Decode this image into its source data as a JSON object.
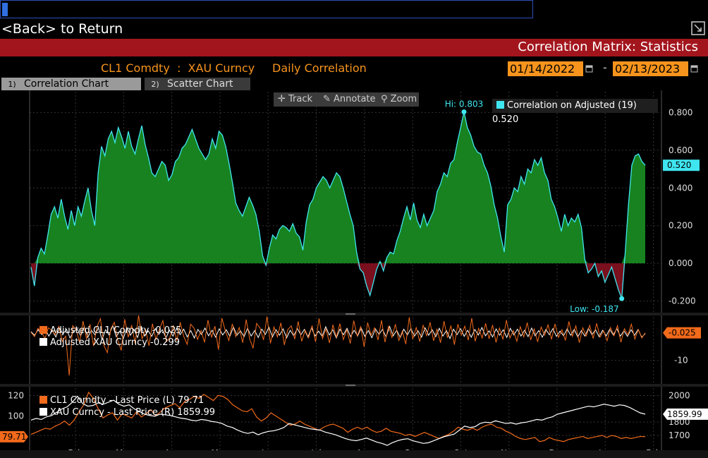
{
  "nav": {
    "back_label": "<Back> to Return"
  },
  "header": {
    "title": "Correlation Matrix: Statistics"
  },
  "params": {
    "pair": "CL1 Comdty  :  XAU Curncy",
    "mode": "Daily Correlation",
    "start_date": "01/14/2022",
    "end_date": "02/13/2023",
    "separator": "-"
  },
  "tabs": [
    {
      "num": "1)",
      "label": "Correlation Chart"
    },
    {
      "num": "2)",
      "label": "Scatter Chart"
    }
  ],
  "toolbar": {
    "track": "Track",
    "annotate": "Annotate",
    "zoom": "Zoom"
  },
  "colors": {
    "green": "#17821f",
    "red": "#7a0f1e",
    "cyan": "#3fe6f0",
    "orange": "#f26a1b",
    "white": "#ffffff",
    "accent": "#f7941d",
    "title_bg": "#a3151d"
  },
  "months": [
    "Feb",
    "Mar",
    "Apr",
    "May",
    "Jun",
    "Jul",
    "Aug",
    "Sep",
    "Oct",
    "Nov",
    "Dec",
    "Jan",
    "Feb"
  ],
  "chart_data": [
    {
      "type": "area",
      "legend": "Correlation on Adjusted (19) 0.520",
      "last_value": "0.520",
      "hi_label": "Hi: 0.803",
      "low_label": "Low: -0.187",
      "ylim": [
        -0.25,
        0.85
      ],
      "yticks": [
        "0.800",
        "0.600",
        "0.400",
        "0.200",
        "0.000",
        "-0.200"
      ],
      "ytick_values": [
        0.8,
        0.6,
        0.4,
        0.2,
        0.0,
        -0.2
      ],
      "series": [
        {
          "name": "Correlation on Adjusted (19)",
          "values": [
            -0.02,
            -0.12,
            0.03,
            0.08,
            0.05,
            0.15,
            0.26,
            0.3,
            0.24,
            0.34,
            0.25,
            0.18,
            0.28,
            0.2,
            0.3,
            0.25,
            0.33,
            0.4,
            0.28,
            0.2,
            0.48,
            0.62,
            0.57,
            0.66,
            0.7,
            0.64,
            0.72,
            0.67,
            0.61,
            0.7,
            0.62,
            0.58,
            0.66,
            0.73,
            0.63,
            0.56,
            0.48,
            0.46,
            0.5,
            0.54,
            0.52,
            0.44,
            0.47,
            0.54,
            0.56,
            0.61,
            0.63,
            0.67,
            0.71,
            0.66,
            0.61,
            0.58,
            0.55,
            0.58,
            0.66,
            0.61,
            0.7,
            0.68,
            0.62,
            0.53,
            0.43,
            0.32,
            0.28,
            0.25,
            0.3,
            0.35,
            0.31,
            0.26,
            0.17,
            0.04,
            -0.01,
            0.08,
            0.15,
            0.13,
            0.18,
            0.2,
            0.19,
            0.17,
            0.21,
            0.16,
            0.14,
            0.07,
            0.22,
            0.31,
            0.34,
            0.4,
            0.43,
            0.46,
            0.44,
            0.4,
            0.44,
            0.48,
            0.46,
            0.4,
            0.33,
            0.26,
            0.2,
            0.06,
            -0.03,
            -0.05,
            -0.12,
            -0.17,
            -0.1,
            -0.03,
            0.01,
            -0.04,
            0.03,
            0.06,
            0.05,
            0.12,
            0.17,
            0.24,
            0.3,
            0.23,
            0.32,
            0.23,
            0.19,
            0.26,
            0.2,
            0.24,
            0.28,
            0.38,
            0.42,
            0.48,
            0.46,
            0.53,
            0.55,
            0.64,
            0.72,
            0.803,
            0.72,
            0.68,
            0.62,
            0.59,
            0.58,
            0.52,
            0.48,
            0.41,
            0.31,
            0.24,
            0.14,
            0.06,
            0.31,
            0.34,
            0.4,
            0.38,
            0.46,
            0.42,
            0.5,
            0.48,
            0.55,
            0.52,
            0.56,
            0.48,
            0.44,
            0.34,
            0.3,
            0.24,
            0.17,
            0.26,
            0.2,
            0.24,
            0.22,
            0.26,
            0.19,
            0.02,
            -0.05,
            -0.03,
            0.0,
            -0.07,
            -0.04,
            -0.1,
            -0.06,
            -0.02,
            -0.08,
            -0.14,
            -0.187,
            0.05,
            0.31,
            0.52,
            0.57,
            0.58,
            0.54,
            0.52
          ]
        }
      ]
    },
    {
      "type": "line",
      "series": [
        {
          "name": "Adjusted CL1 Comdty",
          "last": "-0.025",
          "values": [
            0.2,
            -1.4,
            1.6,
            0.4,
            -2.1,
            1.8,
            0.9,
            -0.7,
            2.3,
            -3.1,
            -1.2,
            -15.5,
            2.6,
            1.1,
            -3.4,
            4.2,
            -2.3,
            3.1,
            -4.8,
            2.2,
            5.1,
            -4.6,
            -7.2,
            1.5,
            3.8,
            -2.7,
            -6.4,
            4.9,
            -1.6,
            2.8,
            -3.9,
            6.3,
            -2.2,
            1.2,
            -4.7,
            3.3,
            -2.4,
            1.3,
            4.4,
            -3.2,
            -1.8,
            2.7,
            -2.9,
            3.8,
            -1.3,
            -4.2,
            3.1,
            1.6,
            -2.4,
            0.8,
            -3.5,
            4.6,
            -1.7,
            2.4,
            -6.1,
            5.3,
            0.7,
            -2.8,
            3.2,
            -1.4,
            1.9,
            -3.6,
            4.8,
            -2.2,
            -5.6,
            3.4,
            1.7,
            -2.6,
            5.9,
            -3.8,
            2.1,
            -1.5,
            3.6,
            -4.4,
            1.2,
            2.5,
            -2.3,
            4.1,
            -3.1,
            0.9,
            -1.8,
            2.6,
            -3.3,
            5.2,
            -2.1,
            1.4,
            -3.7,
            2.9,
            -1.6,
            3.3,
            -2.5,
            1.1,
            -3.9,
            4.4,
            -1.2,
            2.2,
            -5.1,
            3.7,
            -0.9,
            1.8,
            -2.6,
            4.5,
            -3.4,
            2.3,
            -1.7,
            3.1,
            -2.8,
            0.6,
            -4.1,
            5.6,
            -2.3,
            1.9,
            -3.2,
            2.7,
            -1.1,
            3.8,
            -2.9,
            1.3,
            -3.6,
            4.2,
            -1.8,
            2.6,
            -4.3,
            3.1,
            -0.8,
            2.4,
            -2.7,
            5.3,
            -3.1,
            1.6,
            -1.9,
            3.4,
            -2.2,
            2.8,
            -3.5,
            1.7,
            -2.4,
            4.6,
            -1.9,
            0.8,
            -3.1,
            2.2,
            -1.5,
            3.7,
            -2.6,
            1.4,
            -3.3,
            2.1,
            -0.9,
            2.9,
            -2.4,
            3.2,
            -1.7,
            1.1,
            -2.8,
            4.1,
            -1.3,
            2.5,
            -3.6,
            1.8,
            -1.2,
            2.7,
            -2.1,
            3.4,
            -1.6,
            0.7,
            -2.9,
            1.9,
            -1.1,
            2.6,
            -3.4,
            1.5,
            -0.8,
            3.1,
            -2.3,
            1.2,
            -1.9,
            -0.025
          ]
        },
        {
          "name": "Adjusted XAU Curncy",
          "last": "-0.299",
          "values": [
            0.4,
            -0.9,
            1.1,
            -0.6,
            1.4,
            -1.2,
            0.8,
            -1.5,
            1.7,
            -0.4,
            1.2,
            -1.9,
            0.6,
            1.3,
            -1.1,
            2.2,
            -1.6,
            0.9,
            -0.7,
            1.8,
            -2.4,
            1.1,
            -0.8,
            2.6,
            -1.4,
            0.6,
            -2.1,
            1.9,
            -0.9,
            1.2,
            -1.7,
            2.3,
            -1.2,
            0.7,
            -1.3,
            1.5,
            -0.6,
            1.1,
            -1.8,
            0.9,
            -1.2,
            1.6,
            -0.7,
            1.3,
            -1.5,
            0.8,
            -1.9,
            1.2,
            -0.6,
            1.7,
            -1.1,
            0.9,
            -1.6,
            1.4,
            -0.8,
            1.1,
            -1.3,
            2.1,
            -0.9,
            0.7,
            -1.4,
            1.6,
            -1.2,
            0.8,
            -1.7,
            1.3,
            -0.6,
            2.0,
            -1.5,
            1.1,
            -0.9,
            1.4,
            -1.8,
            0.9,
            -1.1,
            1.5,
            -0.7,
            1.2,
            -1.6,
            1.8,
            -1.2,
            0.6,
            -1.3,
            2.2,
            -0.8,
            1.1,
            -1.9,
            1.3,
            -0.7,
            1.6,
            -1.4,
            0.9,
            -1.1,
            1.7,
            -1.3,
            0.8,
            -1.8,
            1.4,
            -0.6,
            1.2,
            -1.5,
            2.3,
            -1.1,
            0.9,
            -1.7,
            1.3,
            -0.8,
            1.5,
            -1.2,
            0.7,
            -1.6,
            1.8,
            -0.9,
            1.1,
            -1.4,
            1.6,
            -1.2,
            0.8,
            -2.1,
            1.3,
            -0.7,
            1.5,
            -1.3,
            0.9,
            -1.6,
            1.2,
            -0.8,
            1.9,
            -1.1,
            0.7,
            -1.5,
            1.4,
            -0.9,
            1.1,
            -1.7,
            1.6,
            -0.8,
            1.3,
            -1.2,
            0.9,
            -1.4,
            1.7,
            -1.1,
            0.8,
            -1.6,
            1.2,
            -0.7,
            1.5,
            -1.3,
            0.6,
            -1.1,
            1.4,
            -0.9,
            1.2,
            -1.5,
            0.8,
            -1.2,
            1.6,
            -0.7,
            1.1,
            -1.4,
            0.9,
            -1.1,
            1.3,
            -0.8,
            1.5,
            -1.2,
            0.7,
            -1.3,
            1.1,
            -0.9,
            1.2,
            -1.6,
            -0.299
          ]
        }
      ],
      "last_value_tag": "-0.025",
      "yticks": [
        "-10"
      ],
      "ytick_values": [
        -10
      ],
      "ylim": [
        -17,
        5
      ]
    },
    {
      "type": "line",
      "series": [
        {
          "name": "CL1 Comdty - Last Price (L)",
          "axis": "left",
          "last": "79.71",
          "values": [
            82,
            84,
            86,
            88,
            87,
            90,
            92,
            95,
            91,
            96,
            104,
            111,
            123,
            117,
            107,
            98,
            101,
            103,
            96,
            102,
            100,
            98,
            104,
            99,
            102,
            106,
            100,
            104,
            108,
            110,
            112,
            108,
            114,
            116,
            119,
            117,
            121,
            118,
            115,
            120,
            119,
            116,
            111,
            108,
            105,
            104,
            107,
            99,
            95,
            98,
            103,
            100,
            97,
            94,
            91,
            92,
            95,
            92,
            90,
            88,
            86,
            89,
            91,
            92,
            90,
            88,
            84,
            87,
            89,
            87,
            89,
            86,
            84,
            85,
            88,
            85,
            84,
            83,
            81,
            82,
            80,
            82,
            84,
            82,
            80,
            78,
            80,
            82,
            85,
            89,
            87,
            86,
            88,
            86,
            89,
            91,
            92,
            89,
            88,
            85,
            83,
            80,
            78,
            77,
            78,
            79,
            75,
            76,
            79,
            77,
            76,
            75,
            77,
            78,
            79,
            80,
            78,
            79,
            80,
            81,
            79,
            81,
            80,
            78,
            79,
            78,
            79,
            80,
            79.71
          ]
        },
        {
          "name": "XAU Curncy - Last Price (R)",
          "axis": "right",
          "last": "1859.99",
          "values": [
            1815,
            1828,
            1820,
            1840,
            1850,
            1875,
            1900,
            1915,
            1950,
            1995,
            1940,
            1920,
            1925,
            1945,
            1935,
            1950,
            1965,
            1935,
            1920,
            1930,
            1900,
            1880,
            1860,
            1850,
            1845,
            1860,
            1855,
            1850,
            1840,
            1830,
            1825,
            1815,
            1810,
            1820,
            1815,
            1805,
            1800,
            1790,
            1770,
            1760,
            1740,
            1725,
            1715,
            1725,
            1705,
            1720,
            1730,
            1735,
            1745,
            1760,
            1790,
            1780,
            1770,
            1760,
            1750,
            1745,
            1740,
            1725,
            1715,
            1705,
            1690,
            1675,
            1665,
            1660,
            1670,
            1680,
            1665,
            1650,
            1640,
            1625,
            1645,
            1660,
            1670,
            1675,
            1660,
            1650,
            1640,
            1645,
            1660,
            1675,
            1690,
            1700,
            1710,
            1740,
            1770,
            1760,
            1765,
            1790,
            1800,
            1795,
            1810,
            1800,
            1790,
            1795,
            1785,
            1795,
            1800,
            1810,
            1820,
            1815,
            1830,
            1840,
            1860,
            1870,
            1880,
            1890,
            1900,
            1910,
            1920,
            1915,
            1925,
            1935,
            1928,
            1920,
            1930,
            1925,
            1910,
            1890,
            1870,
            1859.99
          ]
        }
      ],
      "left_ticks": [
        "120",
        "100"
      ],
      "left_tick_values": [
        120,
        100
      ],
      "left_ylim": [
        70,
        125
      ],
      "left_tag": "79.71",
      "right_ticks": [
        "2000",
        "1800",
        "1700"
      ],
      "right_tick_values": [
        2000,
        1800,
        1700
      ],
      "right_ylim": [
        1615,
        2040
      ],
      "right_tag": "1859.99"
    }
  ]
}
